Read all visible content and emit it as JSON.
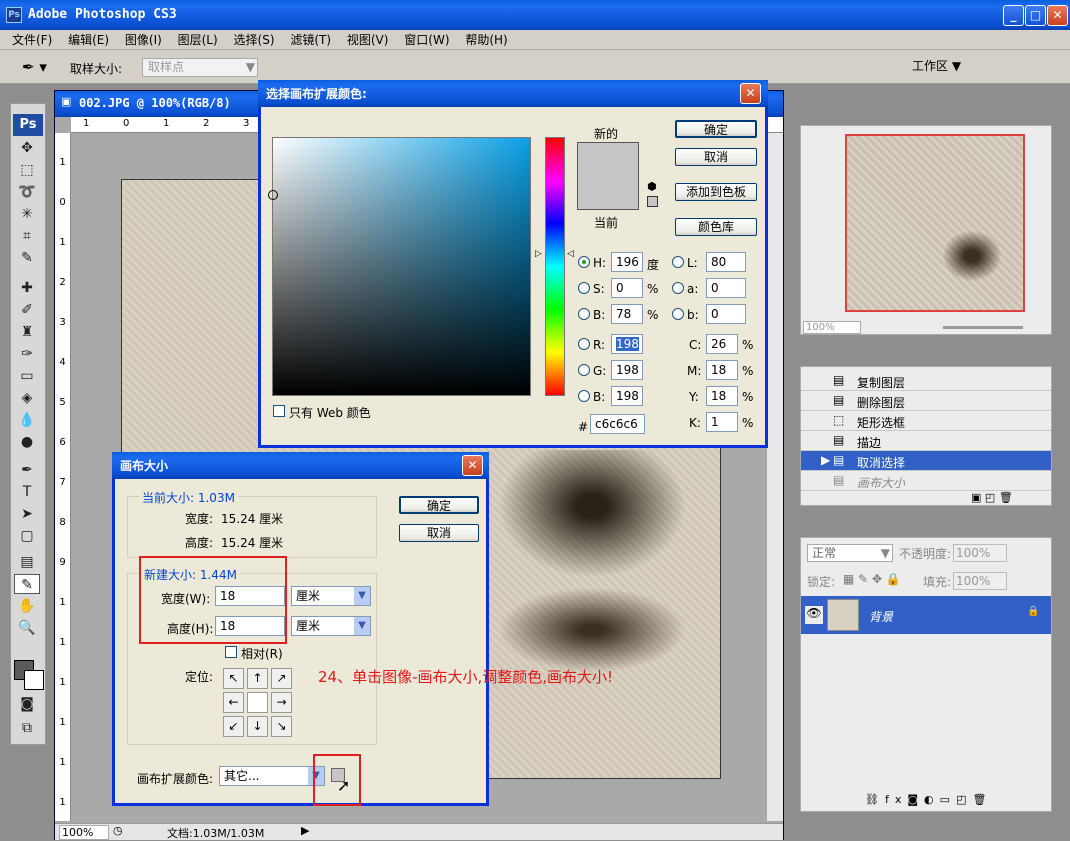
{
  "app": {
    "title": "Adobe Photoshop CS3",
    "ps_badge": "Ps"
  },
  "menu": [
    "文件(F)",
    "编辑(E)",
    "图像(I)",
    "图层(L)",
    "选择(S)",
    "滤镜(T)",
    "视图(V)",
    "窗口(W)",
    "帮助(H)"
  ],
  "options": {
    "sample_label": "取样大小:",
    "sample_value": "取样点",
    "workspace": "工作区 ▼"
  },
  "document": {
    "title": "002.JPG @ 100%(RGB/8)",
    "zoom": "100%",
    "doc_info": "文档:1.03M/1.03M"
  },
  "color_picker": {
    "title": "选择画布扩展颜色:",
    "new_label": "新的",
    "current_label": "当前",
    "buttons": {
      "ok": "确定",
      "cancel": "取消",
      "add_swatch": "添加到色板",
      "library": "颜色库"
    },
    "fields": {
      "H": "196",
      "S": "0",
      "B": "78",
      "R": "198",
      "G": "198",
      "Bv": "198",
      "L": "80",
      "a": "0",
      "b": "0",
      "C": "26",
      "M": "18",
      "Y": "18",
      "K": "1"
    },
    "labels": {
      "H": "H:",
      "S": "S:",
      "B": "B:",
      "R": "R:",
      "G": "G:",
      "Bv": "B:",
      "L": "L:",
      "a": "a:",
      "b": "b:",
      "C": "C:",
      "M": "M:",
      "Y": "Y:",
      "K": "K:"
    },
    "units": {
      "deg": "度",
      "pct": "%"
    },
    "hex_label": "#",
    "hex": "c6c6c6",
    "web_only": "只有 Web 颜色",
    "new_color": "#c6c6c6",
    "current_color": "#c6c6c6"
  },
  "canvas_size": {
    "title": "画布大小",
    "current_legend": "当前大小: 1.03M",
    "current_width_label": "宽度:",
    "current_width": "15.24 厘米",
    "current_height_label": "高度:",
    "current_height": "15.24 厘米",
    "new_legend": "新建大小: 1.44M",
    "width_label": "宽度(W):",
    "width": "18",
    "width_unit": "厘米",
    "height_label": "高度(H):",
    "height": "18",
    "height_unit": "厘米",
    "relative": "相对(R)",
    "anchor_label": "定位:",
    "ext_color_label": "画布扩展颜色:",
    "ext_color_value": "其它...",
    "ok": "确定",
    "cancel": "取消",
    "anchors": [
      "↖",
      "↑",
      "↗",
      "←",
      "",
      "→",
      "↙",
      "↓",
      "↘"
    ]
  },
  "annotation": "24、单击图像-画布大小,调整颜色,画布大小!",
  "navigator": {
    "zoom": "100%"
  },
  "history": {
    "items": [
      "复制图层",
      "删除图层",
      "矩形选框",
      "描边",
      "取消选择",
      "画布大小"
    ]
  },
  "layers": {
    "blend_mode": "正常",
    "opacity_label": "不透明度:",
    "opacity": "100%",
    "lock_label": "锁定:",
    "fill_label": "填充:",
    "fill": "100%",
    "layer_name": "背景"
  }
}
